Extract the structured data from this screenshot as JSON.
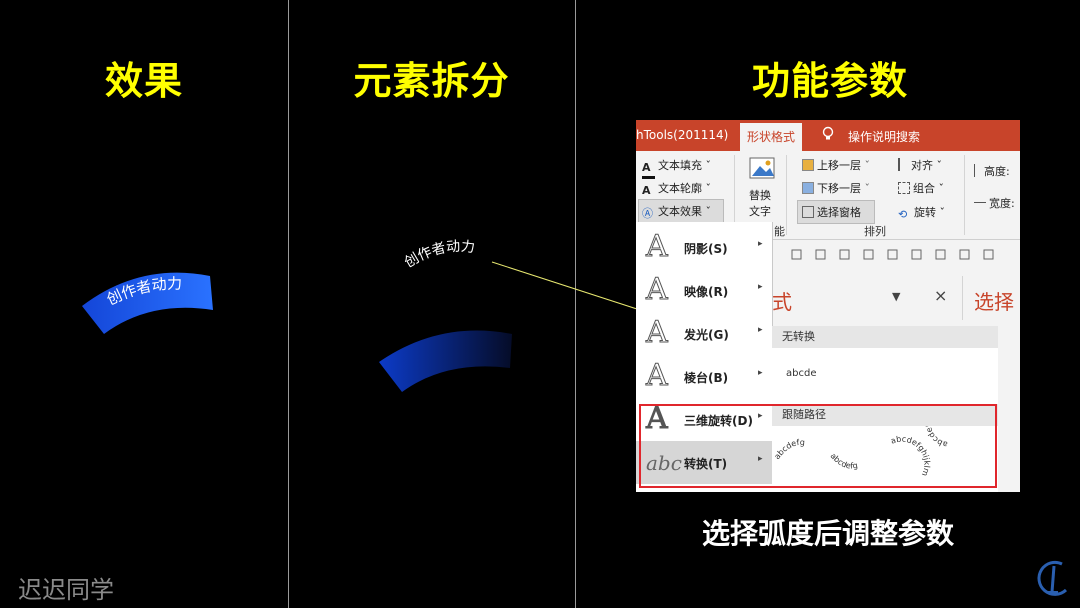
{
  "headings": {
    "effect": "效果",
    "elements": "元素拆分",
    "params": "功能参数"
  },
  "effect_panel": {
    "arc_text": "创作者动力"
  },
  "elements_panel": {
    "floating_text": "创作者动力"
  },
  "caption": "选择弧度后调整参数",
  "watermark": "迟迟同学",
  "colors": {
    "heading": "#ffff00",
    "arc_blue": "#1a5ff0",
    "ribbon_accent": "#c8442a",
    "highlight": "#e0262c"
  },
  "ribbon": {
    "left_tab": "hTools(201114)",
    "active_tab": "形状格式",
    "search_tab": "操作说明搜索",
    "text_fill": "文本填充 ˇ",
    "text_outline": "文本轮廓 ˇ",
    "text_effects": "文本效果 ˇ",
    "alt_text_line1": "替换",
    "alt_text_line2": "文字",
    "group_cut": "能",
    "bring_forward": "上移一层",
    "send_backward": "下移一层",
    "selection_pane": "选择窗格",
    "align": "对齐 ˇ",
    "group": "组合 ˇ",
    "rotate": "旋转 ˇ",
    "arrange_caption": "排列",
    "height": "高度:",
    "width": "宽度:"
  },
  "pane": {
    "title_left": "式",
    "title_right": "选择",
    "close": "×",
    "dropdown": "▼"
  },
  "menu": {
    "items": [
      {
        "label": "阴影(S)",
        "icon": "shadow-A-icon"
      },
      {
        "label": "映像(R)",
        "icon": "reflection-A-icon"
      },
      {
        "label": "发光(G)",
        "icon": "glow-A-icon"
      },
      {
        "label": "棱台(B)",
        "icon": "bevel-A-icon"
      },
      {
        "label": "三维旋转(D)",
        "icon": "3d-rotation-A-icon"
      },
      {
        "label": "转换(T)",
        "icon": "transform-abc-icon"
      }
    ],
    "arrow": "▸",
    "abc_glyph": "abc",
    "big_a": "A"
  },
  "submenu": {
    "no_transform": "无转换",
    "sample": "abcde",
    "follow_path": "跟随路径",
    "path_arc_up": "abcdefg",
    "path_arc_down": "abcdefg",
    "path_circle": "abcdefghijklm",
    "path_button": "abcdefGhij klmnop"
  }
}
